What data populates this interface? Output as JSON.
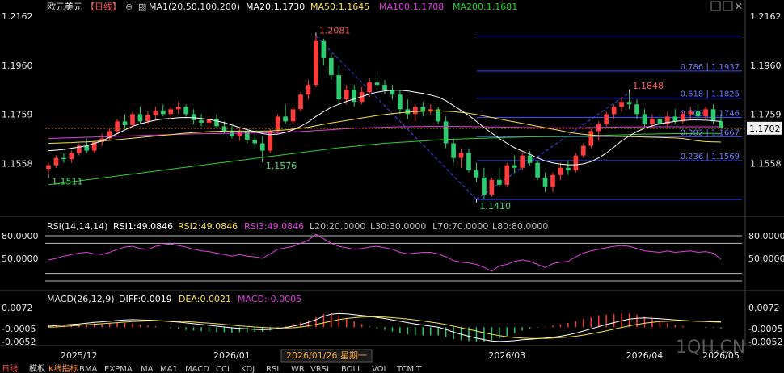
{
  "header": {
    "symbol": "欧元美元",
    "period": "【日线】",
    "ma_label": "MA1(20,50,100,200)",
    "ma20": "MA20:1.1730",
    "ma50": "MA50:1.1645",
    "ma100": "MA100:1.1708",
    "ma200": "MA200:1.1681"
  },
  "price_axis": {
    "ticks": [
      "1.2162",
      "1.1960",
      "1.1759",
      "1.1558"
    ],
    "current_price": "1.1702"
  },
  "fib_levels": [
    "0.786 | 1.1937",
    "0.618 | 1.1825",
    "0.500 | 1.1746",
    "0.382 | 1.1667",
    "0.236 | 1.1569"
  ],
  "annotations": {
    "high1": "1.2081",
    "low1": "1.1511",
    "low2": "1.1576",
    "low3": "1.1410",
    "high2": "1.1848"
  },
  "rsi": {
    "header": "RSI(14,14,14)",
    "rsi1": "RSI1:49.0846",
    "rsi2": "RSI2:49.0846",
    "rsi3": "RSI3:49.0846",
    "l20": "L20:20.0000",
    "l30": "L30:30.0000",
    "l70": "L70:70.0000",
    "l80": "L80:80.0000",
    "ticks": [
      "80.0000",
      "50.0000"
    ]
  },
  "macd": {
    "header": "MACD(26,12,9)",
    "diff": "DIFF:0.0019",
    "dea": "DEA:0.0021",
    "macd": "MACD:-0.0005",
    "ticks": [
      "0.0072",
      "-0.0005",
      "-0.0052"
    ]
  },
  "time_axis": {
    "labels": [
      "2025/12",
      "2026/01",
      "2026/03",
      "2026/04",
      "2026/05"
    ],
    "cursor": "2026/01/26 星期一"
  },
  "tabs": [
    "日线",
    "模板",
    "K线指标",
    "BMA",
    "EXPMA",
    "MA",
    "MA1",
    "MACD",
    "CCI",
    "KDJ",
    "RSI",
    "WR",
    "VRSI",
    "BOLL",
    "VOL",
    "TCMIT"
  ],
  "watermark": "1QH.CN",
  "colors": {
    "up": "#ff3b3b",
    "down": "#2ecc71",
    "ma20": "#ffffff",
    "ma50": "#f5e14a",
    "ma100": "#e040e0",
    "ma200": "#30d030",
    "fib": "#3a4bff"
  },
  "chart_data": {
    "type": "candlestick",
    "symbol": "EUR/USD",
    "ylim": [
      1.138,
      1.2162
    ],
    "ohlc": [
      [
        1.1535,
        1.156,
        1.1511,
        1.155
      ],
      [
        1.155,
        1.159,
        1.154,
        1.158
      ],
      [
        1.158,
        1.16,
        1.156,
        1.1575
      ],
      [
        1.1575,
        1.161,
        1.156,
        1.16
      ],
      [
        1.16,
        1.164,
        1.159,
        1.163
      ],
      [
        1.163,
        1.166,
        1.16,
        1.161
      ],
      [
        1.161,
        1.165,
        1.16,
        1.1645
      ],
      [
        1.1645,
        1.168,
        1.163,
        1.166
      ],
      [
        1.166,
        1.17,
        1.165,
        1.169
      ],
      [
        1.169,
        1.174,
        1.168,
        1.173
      ],
      [
        1.173,
        1.176,
        1.17,
        1.1715
      ],
      [
        1.1715,
        1.177,
        1.1705,
        1.176
      ],
      [
        1.176,
        1.179,
        1.172,
        1.173
      ],
      [
        1.173,
        1.177,
        1.172,
        1.1755
      ],
      [
        1.1755,
        1.179,
        1.174,
        1.1775
      ],
      [
        1.1775,
        1.18,
        1.175,
        1.176
      ],
      [
        1.176,
        1.179,
        1.174,
        1.178
      ],
      [
        1.178,
        1.181,
        1.176,
        1.179
      ],
      [
        1.179,
        1.18,
        1.175,
        1.176
      ],
      [
        1.176,
        1.178,
        1.172,
        1.1735
      ],
      [
        1.1735,
        1.176,
        1.171,
        1.1725
      ],
      [
        1.1725,
        1.175,
        1.17,
        1.174
      ],
      [
        1.174,
        1.176,
        1.17,
        1.171
      ],
      [
        1.171,
        1.173,
        1.168,
        1.169
      ],
      [
        1.169,
        1.171,
        1.166,
        1.167
      ],
      [
        1.167,
        1.17,
        1.165,
        1.1685
      ],
      [
        1.1685,
        1.17,
        1.164,
        1.1655
      ],
      [
        1.1655,
        1.168,
        1.162,
        1.164
      ],
      [
        1.164,
        1.167,
        1.1576,
        1.161
      ],
      [
        1.161,
        1.17,
        1.16,
        1.169
      ],
      [
        1.169,
        1.176,
        1.168,
        1.175
      ],
      [
        1.175,
        1.18,
        1.172,
        1.173
      ],
      [
        1.173,
        1.179,
        1.172,
        1.178
      ],
      [
        1.178,
        1.185,
        1.177,
        1.184
      ],
      [
        1.184,
        1.19,
        1.182,
        1.188
      ],
      [
        1.188,
        1.2081,
        1.187,
        1.206
      ],
      [
        1.206,
        1.207,
        1.196,
        1.199
      ],
      [
        1.199,
        1.201,
        1.19,
        1.192
      ],
      [
        1.192,
        1.196,
        1.18,
        1.182
      ],
      [
        1.182,
        1.188,
        1.18,
        1.186
      ],
      [
        1.186,
        1.188,
        1.179,
        1.181
      ],
      [
        1.181,
        1.187,
        1.18,
        1.185
      ],
      [
        1.185,
        1.191,
        1.183,
        1.189
      ],
      [
        1.189,
        1.192,
        1.186,
        1.188
      ],
      [
        1.188,
        1.19,
        1.184,
        1.186
      ],
      [
        1.186,
        1.188,
        1.182,
        1.184
      ],
      [
        1.184,
        1.186,
        1.176,
        1.178
      ],
      [
        1.178,
        1.182,
        1.174,
        1.176
      ],
      [
        1.176,
        1.18,
        1.173,
        1.179
      ],
      [
        1.179,
        1.181,
        1.175,
        1.177
      ],
      [
        1.177,
        1.18,
        1.176,
        1.178
      ],
      [
        1.178,
        1.179,
        1.172,
        1.173
      ],
      [
        1.173,
        1.175,
        1.162,
        1.164
      ],
      [
        1.164,
        1.166,
        1.156,
        1.158
      ],
      [
        1.158,
        1.162,
        1.154,
        1.16
      ],
      [
        1.16,
        1.162,
        1.152,
        1.153
      ],
      [
        1.153,
        1.156,
        1.148,
        1.15
      ],
      [
        1.15,
        1.154,
        1.141,
        1.143
      ],
      [
        1.143,
        1.15,
        1.142,
        1.149
      ],
      [
        1.149,
        1.154,
        1.146,
        1.147
      ],
      [
        1.147,
        1.156,
        1.146,
        1.155
      ],
      [
        1.155,
        1.159,
        1.152,
        1.154
      ],
      [
        1.154,
        1.16,
        1.153,
        1.159
      ],
      [
        1.159,
        1.161,
        1.155,
        1.156
      ],
      [
        1.156,
        1.157,
        1.149,
        1.15
      ],
      [
        1.15,
        1.152,
        1.144,
        1.146
      ],
      [
        1.146,
        1.152,
        1.144,
        1.151
      ],
      [
        1.151,
        1.156,
        1.149,
        1.154
      ],
      [
        1.154,
        1.157,
        1.151,
        1.153
      ],
      [
        1.153,
        1.16,
        1.152,
        1.159
      ],
      [
        1.159,
        1.164,
        1.158,
        1.163
      ],
      [
        1.163,
        1.17,
        1.162,
        1.169
      ],
      [
        1.169,
        1.173,
        1.165,
        1.172
      ],
      [
        1.172,
        1.177,
        1.171,
        1.176
      ],
      [
        1.176,
        1.18,
        1.174,
        1.179
      ],
      [
        1.179,
        1.183,
        1.177,
        1.181
      ],
      [
        1.181,
        1.1848,
        1.178,
        1.18
      ],
      [
        1.18,
        1.182,
        1.174,
        1.176
      ],
      [
        1.176,
        1.178,
        1.17,
        1.172
      ],
      [
        1.172,
        1.176,
        1.17,
        1.174
      ],
      [
        1.174,
        1.176,
        1.171,
        1.172
      ],
      [
        1.172,
        1.177,
        1.171,
        1.175
      ],
      [
        1.175,
        1.178,
        1.172,
        1.173
      ],
      [
        1.173,
        1.177,
        1.172,
        1.176
      ],
      [
        1.176,
        1.179,
        1.174,
        1.177
      ],
      [
        1.177,
        1.18,
        1.174,
        1.175
      ],
      [
        1.175,
        1.179,
        1.174,
        1.178
      ],
      [
        1.178,
        1.18,
        1.172,
        1.173
      ],
      [
        1.173,
        1.176,
        1.17,
        1.1702
      ]
    ],
    "ma20": [
      1.161,
      1.1612,
      1.1615,
      1.162,
      1.1625,
      1.163,
      1.164,
      1.165,
      1.1665,
      1.168,
      1.1695,
      1.171,
      1.172,
      1.1728,
      1.1735,
      1.174,
      1.1742,
      1.1745,
      1.1746,
      1.1745,
      1.1742,
      1.1738,
      1.1732,
      1.1725,
      1.1715,
      1.1705,
      1.1696,
      1.1688,
      1.168,
      1.1676,
      1.1678,
      1.1685,
      1.1695,
      1.171,
      1.1728,
      1.175,
      1.177,
      1.1788,
      1.18,
      1.1812,
      1.1822,
      1.1832,
      1.1842,
      1.185,
      1.1855,
      1.1858,
      1.1858,
      1.1855,
      1.185,
      1.1845,
      1.1838,
      1.183,
      1.1815,
      1.1795,
      1.1775,
      1.1755,
      1.173,
      1.1705,
      1.1682,
      1.166,
      1.164,
      1.1622,
      1.1608,
      1.1595,
      1.158,
      1.1568,
      1.156,
      1.1555,
      1.1552,
      1.1552,
      1.1556,
      1.1565,
      1.158,
      1.16,
      1.1625,
      1.165,
      1.167,
      1.1688,
      1.1702,
      1.1712,
      1.172,
      1.1726,
      1.173,
      1.1734,
      1.1736,
      1.1736,
      1.1735,
      1.1733,
      1.173
    ],
    "ma50": [
      1.164,
      1.1641,
      1.1642,
      1.1643,
      1.1645,
      1.1646,
      1.1648,
      1.165,
      1.1652,
      1.1655,
      1.1658,
      1.1661,
      1.1664,
      1.1667,
      1.167,
      1.1673,
      1.1676,
      1.1679,
      1.1682,
      1.1684,
      1.1686,
      1.1688,
      1.1689,
      1.169,
      1.169,
      1.169,
      1.169,
      1.169,
      1.169,
      1.1691,
      1.1693,
      1.1695,
      1.1698,
      1.1702,
      1.1706,
      1.1712,
      1.1718,
      1.1724,
      1.1729,
      1.1734,
      1.1739,
      1.1744,
      1.1749,
      1.1754,
      1.1758,
      1.1762,
      1.1765,
      1.1768,
      1.177,
      1.1772,
      1.1773,
      1.1773,
      1.1772,
      1.177,
      1.1767,
      1.1763,
      1.1758,
      1.1752,
      1.1746,
      1.174,
      1.1734,
      1.1728,
      1.1722,
      1.1716,
      1.171,
      1.1704,
      1.1698,
      1.1692,
      1.1686,
      1.1681,
      1.1677,
      1.1674,
      1.1672,
      1.1671,
      1.167,
      1.1669,
      1.1668,
      1.1667,
      1.1666,
      1.1665,
      1.1664,
      1.1663,
      1.1662,
      1.166,
      1.1655,
      1.165,
      1.1647,
      1.1646,
      1.1645
    ],
    "ma100": [
      1.166,
      1.1661,
      1.1662,
      1.1663,
      1.1664,
      1.1665,
      1.1666,
      1.1667,
      1.1668,
      1.1669,
      1.167,
      1.1671,
      1.1672,
      1.1673,
      1.1674,
      1.1675,
      1.1676,
      1.1677,
      1.1678,
      1.1679,
      1.1679,
      1.168,
      1.168,
      1.1681,
      1.1681,
      1.1682,
      1.1682,
      1.1683,
      1.1683,
      1.1684,
      1.1685,
      1.1686,
      1.1687,
      1.1688,
      1.169,
      1.1692,
      1.1694,
      1.1696,
      1.1698,
      1.17,
      1.1702,
      1.1703,
      1.1704,
      1.1705,
      1.1706,
      1.1707,
      1.1708,
      1.1708,
      1.1709,
      1.1709,
      1.171,
      1.171,
      1.171,
      1.171,
      1.1709,
      1.1709,
      1.1708,
      1.1708,
      1.1707,
      1.1707,
      1.1706,
      1.1706,
      1.1705,
      1.1705,
      1.1704,
      1.1704,
      1.1704,
      1.1704,
      1.1704,
      1.1704,
      1.1704,
      1.1705,
      1.1705,
      1.1706,
      1.1706,
      1.1707,
      1.1707,
      1.1707,
      1.1708,
      1.1708,
      1.1708,
      1.1708,
      1.1708,
      1.1708,
      1.1708,
      1.1708,
      1.1708,
      1.1708,
      1.1708
    ],
    "ma200": [
      1.147,
      1.1474,
      1.1478,
      1.1482,
      1.1486,
      1.149,
      1.1494,
      1.1498,
      1.1502,
      1.1506,
      1.151,
      1.1514,
      1.1518,
      1.1522,
      1.1526,
      1.153,
      1.1534,
      1.1538,
      1.1542,
      1.1546,
      1.155,
      1.1554,
      1.1558,
      1.1562,
      1.1566,
      1.157,
      1.1574,
      1.1578,
      1.1582,
      1.1586,
      1.159,
      1.1594,
      1.1598,
      1.1602,
      1.1606,
      1.161,
      1.1614,
      1.1618,
      1.1622,
      1.1625,
      1.1628,
      1.1631,
      1.1634,
      1.1637,
      1.164,
      1.1642,
      1.1644,
      1.1646,
      1.1648,
      1.165,
      1.1652,
      1.1654,
      1.1656,
      1.1657,
      1.1658,
      1.1659,
      1.166,
      1.1661,
      1.1662,
      1.1663,
      1.1664,
      1.1665,
      1.1666,
      1.1667,
      1.1667,
      1.1668,
      1.1668,
      1.1669,
      1.1669,
      1.167,
      1.167,
      1.1671,
      1.1672,
      1.1673,
      1.1674,
      1.1675,
      1.1676,
      1.1677,
      1.1678,
      1.1678,
      1.1679,
      1.1679,
      1.168,
      1.168,
      1.168,
      1.1681,
      1.1681,
      1.1681,
      1.1681
    ],
    "rsi": [
      48,
      50,
      53,
      55,
      57,
      58,
      56,
      55,
      58,
      62,
      65,
      66,
      63,
      62,
      66,
      68,
      69,
      67,
      65,
      62,
      60,
      59,
      57,
      55,
      53,
      55,
      53,
      52,
      50,
      56,
      62,
      64,
      66,
      70,
      74,
      82,
      76,
      70,
      66,
      64,
      62,
      63,
      65,
      66,
      64,
      62,
      58,
      56,
      57,
      58,
      58,
      56,
      52,
      47,
      45,
      44,
      42,
      38,
      33,
      40,
      42,
      46,
      48,
      46,
      42,
      38,
      43,
      45,
      46,
      52,
      57,
      60,
      62,
      64,
      66,
      67,
      66,
      63,
      60,
      59,
      58,
      60,
      58,
      59,
      60,
      58,
      59,
      57,
      49
    ],
    "macd_diff": [
      0.0004,
      0.0006,
      0.0008,
      0.001,
      0.0012,
      0.0015,
      0.0018,
      0.002,
      0.0022,
      0.0025,
      0.0027,
      0.0028,
      0.0027,
      0.0026,
      0.0025,
      0.0023,
      0.0021,
      0.0019,
      0.0016,
      0.0013,
      0.001,
      0.0007,
      0.0004,
      0.0001,
      -0.0002,
      -0.0004,
      -0.0006,
      -0.0008,
      -0.0009,
      -0.0008,
      -0.0005,
      -0.0001,
      0.0004,
      0.001,
      0.0018,
      0.0028,
      0.004,
      0.0048,
      0.005,
      0.0049,
      0.0046,
      0.0043,
      0.004,
      0.0036,
      0.0032,
      0.0027,
      0.0022,
      0.0017,
      0.0012,
      0.0008,
      0.0004,
      0.0,
      -0.0008,
      -0.0018,
      -0.0026,
      -0.0033,
      -0.004,
      -0.0046,
      -0.005,
      -0.0052,
      -0.0051,
      -0.0049,
      -0.0046,
      -0.0044,
      -0.0042,
      -0.004,
      -0.0037,
      -0.0033,
      -0.0028,
      -0.0022,
      -0.0014,
      -0.0006,
      0.0002,
      0.001,
      0.0017,
      0.0024,
      0.003,
      0.0033,
      0.0034,
      0.0033,
      0.0031,
      0.0029,
      0.0027,
      0.0025,
      0.0023,
      0.0022,
      0.0021,
      0.002,
      0.0019
    ],
    "macd_dea": [
      0.0,
      0.0001,
      0.0003,
      0.0005,
      0.0007,
      0.0009,
      0.0011,
      0.0013,
      0.0015,
      0.0017,
      0.0019,
      0.0021,
      0.0022,
      0.0023,
      0.0023,
      0.0023,
      0.0023,
      0.0022,
      0.0021,
      0.0019,
      0.0017,
      0.0015,
      0.0013,
      0.001,
      0.0008,
      0.0005,
      0.0003,
      0.0001,
      -0.0001,
      -0.0002,
      -0.0003,
      -0.0003,
      -0.0002,
      0.0001,
      0.0005,
      0.001,
      0.0016,
      0.0022,
      0.0028,
      0.0032,
      0.0035,
      0.0037,
      0.0038,
      0.0038,
      0.0037,
      0.0035,
      0.0033,
      0.003,
      0.0027,
      0.0023,
      0.0019,
      0.0015,
      0.001,
      0.0004,
      -0.0002,
      -0.0008,
      -0.0014,
      -0.002,
      -0.0026,
      -0.0031,
      -0.0035,
      -0.0038,
      -0.004,
      -0.0041,
      -0.0041,
      -0.0041,
      -0.004,
      -0.0038,
      -0.0036,
      -0.0033,
      -0.0029,
      -0.0024,
      -0.0019,
      -0.0013,
      -0.0007,
      -0.0001,
      0.0005,
      0.001,
      0.0015,
      0.0018,
      0.0021,
      0.0022,
      0.0023,
      0.0023,
      0.0023,
      0.0022,
      0.0022,
      0.0021,
      0.0021
    ]
  }
}
